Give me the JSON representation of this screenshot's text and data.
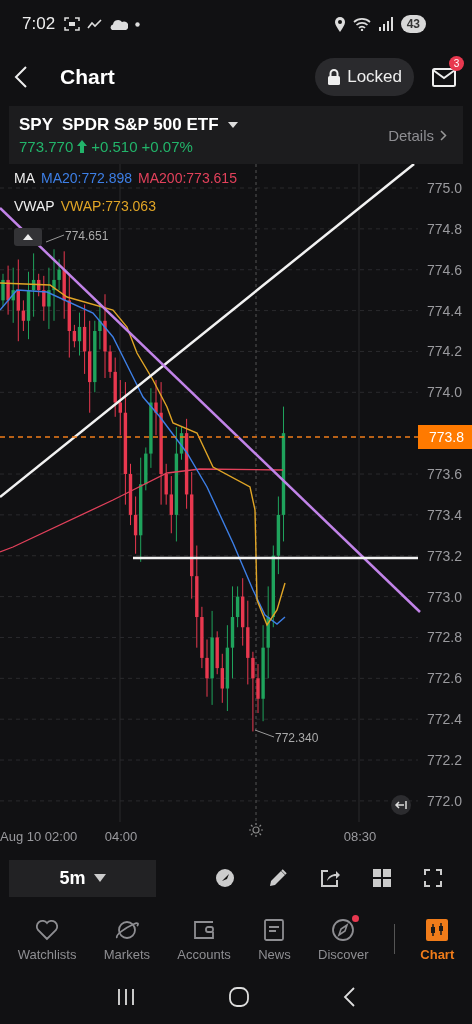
{
  "status_bar": {
    "time": "7:02",
    "battery": "43"
  },
  "header": {
    "title": "Chart",
    "lock_button": "Locked",
    "mail_badge": "3"
  },
  "quote": {
    "symbol": "SPY",
    "name": "SPDR S&P 500 ETF",
    "price": "773.770",
    "change": "+0.510",
    "change_pct": "+0.07%",
    "details": "Details"
  },
  "indicators": [
    {
      "name": "MA",
      "values": [
        {
          "text": "MA20:772.898",
          "color": "#3d7fe6"
        },
        {
          "text": "MA200:773.615",
          "color": "#e2415b"
        }
      ]
    },
    {
      "name": "VWAP",
      "values": [
        {
          "text": "VWAP:773.063",
          "color": "#e0a526"
        }
      ]
    }
  ],
  "chart": {
    "y_ticks": [
      "775.0",
      "774.8",
      "774.6",
      "774.4",
      "774.2",
      "774.0",
      "773.6",
      "773.4",
      "773.2",
      "773.0",
      "772.8",
      "772.6",
      "772.4",
      "772.2",
      "772.0"
    ],
    "current_price": "773.8",
    "high_marker": "774.651",
    "low_marker": "772.340",
    "x_ticks": [
      "Aug 10 02:00",
      "04:00",
      "08:30"
    ]
  },
  "toolbar": {
    "interval": "5m"
  },
  "tabs": [
    {
      "label": "Watchlists",
      "selected": false,
      "notification": false
    },
    {
      "label": "Markets",
      "selected": false,
      "notification": false
    },
    {
      "label": "Accounts",
      "selected": false,
      "notification": false
    },
    {
      "label": "News",
      "selected": false,
      "notification": false
    },
    {
      "label": "Discover",
      "selected": false,
      "notification": true
    },
    {
      "label": "Chart",
      "selected": true,
      "notification": false
    }
  ]
}
